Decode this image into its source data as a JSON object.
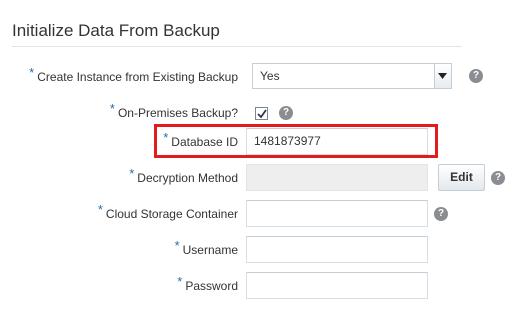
{
  "section": {
    "title": "Initialize Data From Backup"
  },
  "fields": {
    "create_instance": {
      "label": "Create Instance from Existing Backup",
      "value": "Yes",
      "required_marker": "*"
    },
    "on_premises": {
      "label": "On-Premises Backup?",
      "checked": true,
      "required_marker": "*"
    },
    "database_id": {
      "label": "Database ID",
      "value": "1481873977",
      "required_marker": "*"
    },
    "decryption_method": {
      "label": "Decryption Method",
      "value": "",
      "required_marker": "*",
      "button_label": "Edit"
    },
    "cloud_storage": {
      "label": "Cloud Storage Container",
      "value": "",
      "required_marker": "*"
    },
    "username": {
      "label": "Username",
      "value": "",
      "required_marker": "*"
    },
    "password": {
      "label": "Password",
      "value": "",
      "required_marker": "*"
    }
  },
  "help_icon_text": "?",
  "colors": {
    "required_marker": "#1f6fb2",
    "highlight": "#e21c1c",
    "help_icon": "#8a8d91"
  }
}
